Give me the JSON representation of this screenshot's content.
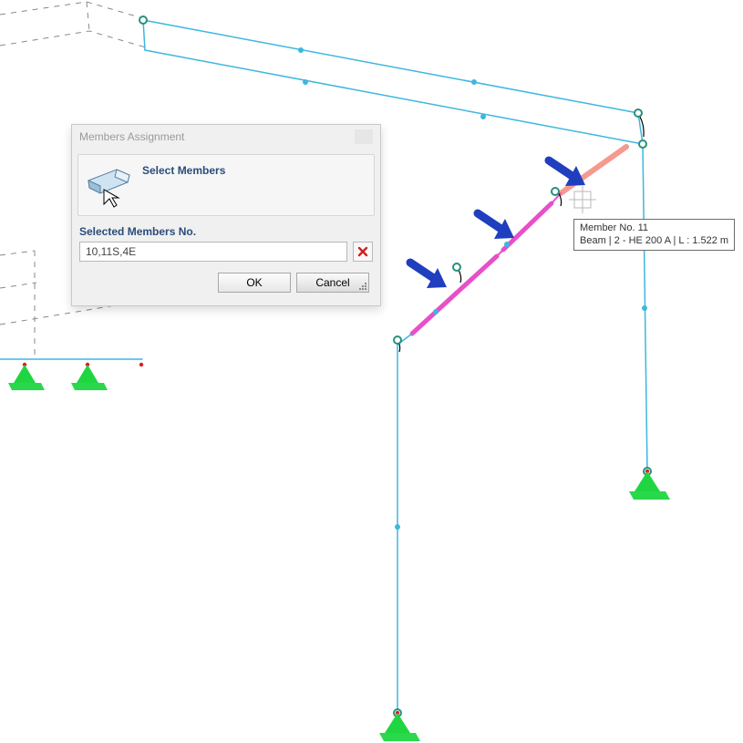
{
  "dialog": {
    "title": "Members Assignment",
    "group_title": "Select Members",
    "selected_label": "Selected Members No.",
    "selected_value": "10,11S,4E",
    "ok_label": "OK",
    "cancel_label": "Cancel"
  },
  "tooltip": {
    "line1": "Member No. 11",
    "line2": "Beam | 2 - HE 200 A | L : 1.522 m"
  },
  "colors": {
    "wire": "#3db7de",
    "highlight_segment": "#e84fc8",
    "highlight_hover": "#f59a8e",
    "support": "#1fd641",
    "node_ring": "#4a8a7a",
    "arrow": "#1f3fbf",
    "dashed": "#888888"
  }
}
